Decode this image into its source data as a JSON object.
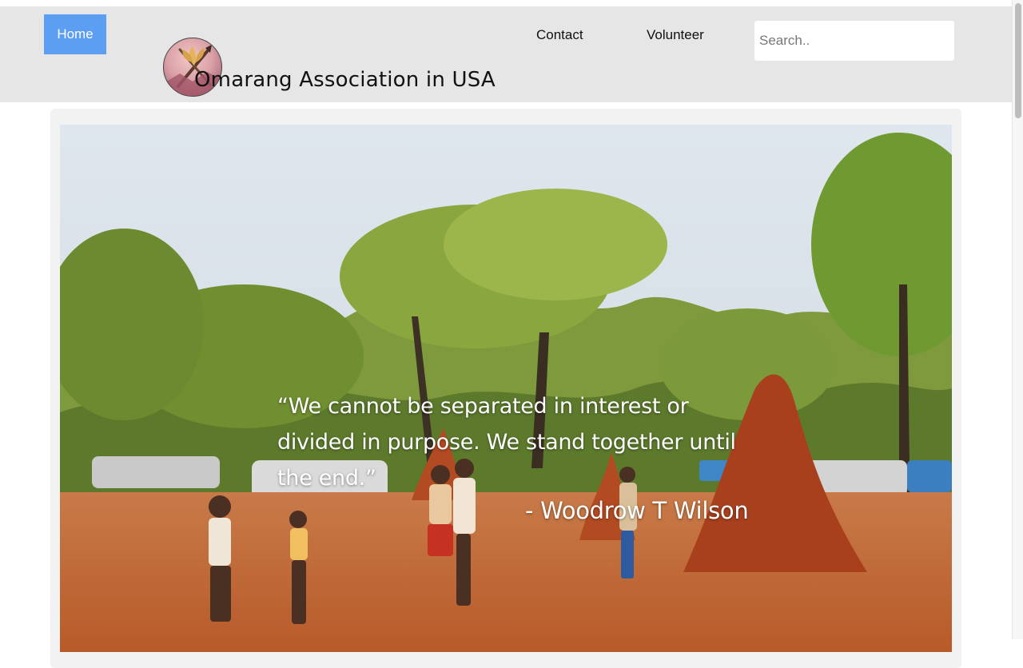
{
  "nav": {
    "home_label": "Home",
    "contact_label": "Contact",
    "volunteer_label": "Volunteer",
    "search_placeholder": "Search.."
  },
  "site": {
    "title": "Omarang Association in USA",
    "logo_icon": "crossed-spear-and-wheat-logo"
  },
  "hero": {
    "image_icon": "village-trees-photo",
    "quote": "“We cannot be separated in interest or divided in purpose. We stand together until the end.”",
    "author": "- Woodrow T Wilson"
  },
  "colors": {
    "home_button": "#5c9ef2",
    "navbar_bg": "#e6e6e6",
    "card_bg": "#f2f2f2"
  }
}
